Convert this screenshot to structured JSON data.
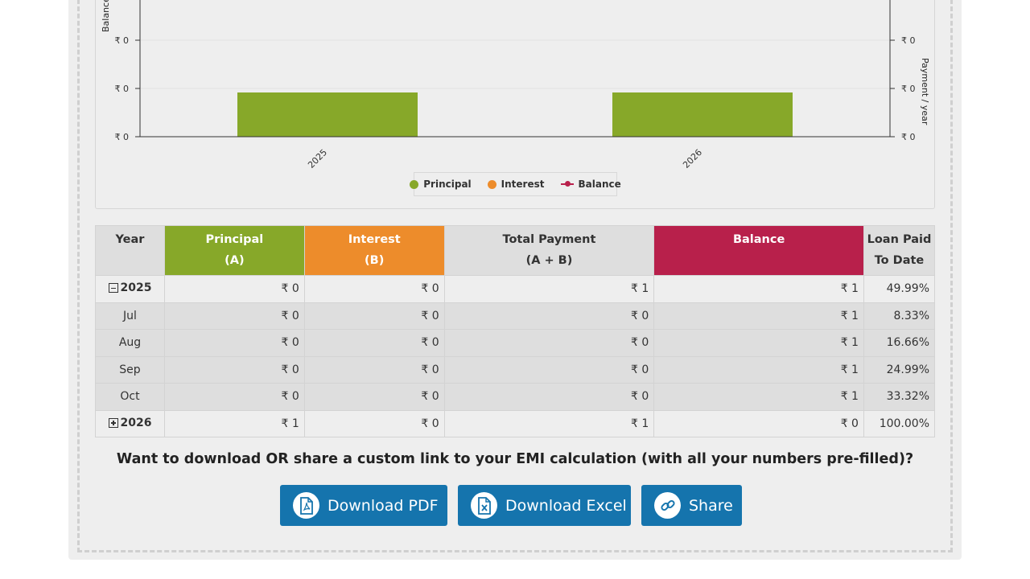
{
  "chart": {
    "y_left_title": "Balance",
    "y_right_title": "Payment / year",
    "y_left_ticks": [
      "₹ 0",
      "₹ 0",
      "₹ 0"
    ],
    "y_right_ticks": [
      "₹ 0",
      "₹ 0",
      "₹ 0"
    ],
    "legend": [
      {
        "label": "Principal",
        "color": "#87a829",
        "icon": "circle-dot"
      },
      {
        "label": "Interest",
        "color": "#ed8c2b",
        "icon": "circle-dot"
      },
      {
        "label": "Balance",
        "color": "#b8204b",
        "icon": "line-dot"
      }
    ]
  },
  "chart_data": {
    "type": "bar",
    "categories": [
      "2025",
      "2026"
    ],
    "series": [
      {
        "name": "Principal",
        "values": [
          0.5,
          0.5
        ],
        "color": "#87a829"
      },
      {
        "name": "Interest",
        "values": [
          0,
          0
        ],
        "color": "#ed8c2b"
      },
      {
        "name": "Balance",
        "values": [
          1,
          0
        ],
        "color": "#b8204b"
      }
    ],
    "ylim": [
      0,
      1
    ],
    "grid": true,
    "legend_position": "bottom-center"
  },
  "table": {
    "headers": {
      "year": "Year",
      "principal": "Principal",
      "principal_sub": "(A)",
      "interest": "Interest",
      "interest_sub": "(B)",
      "total": "Total Payment",
      "total_sub": "(A + B)",
      "balance": "Balance",
      "paid": "Loan Paid",
      "paid_sub": "To Date"
    },
    "rows": [
      {
        "year": "2025",
        "principal": "₹ 0",
        "interest": "₹ 0",
        "total": "₹ 1",
        "balance": "₹ 1",
        "paid": "49.99%"
      },
      {
        "month": "Jul",
        "principal": "₹ 0",
        "interest": "₹ 0",
        "total": "₹ 0",
        "balance": "₹ 1",
        "paid": "8.33%"
      },
      {
        "month": "Aug",
        "principal": "₹ 0",
        "interest": "₹ 0",
        "total": "₹ 0",
        "balance": "₹ 1",
        "paid": "16.66%"
      },
      {
        "month": "Sep",
        "principal": "₹ 0",
        "interest": "₹ 0",
        "total": "₹ 0",
        "balance": "₹ 1",
        "paid": "24.99%"
      },
      {
        "month": "Oct",
        "principal": "₹ 0",
        "interest": "₹ 0",
        "total": "₹ 0",
        "balance": "₹ 1",
        "paid": "33.32%"
      },
      {
        "year": "2026",
        "principal": "₹ 1",
        "interest": "₹ 0",
        "total": "₹ 1",
        "balance": "₹ 0",
        "paid": "100.00%"
      }
    ]
  },
  "cta": {
    "text": "Want to download OR share a custom link to your EMI calculation (with all your numbers pre-filled)?",
    "download_pdf": "Download PDF",
    "download_excel": "Download Excel",
    "share": "Share"
  },
  "colors": {
    "principal": "#87a829",
    "interest": "#ed8c2b",
    "balance": "#b8204b",
    "button": "#1574ad"
  }
}
